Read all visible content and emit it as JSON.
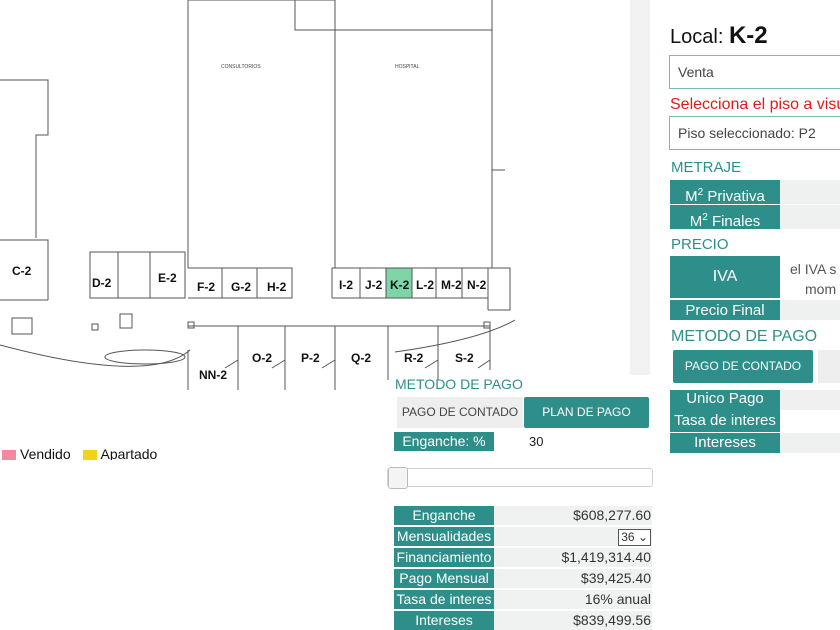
{
  "floorplan": {
    "zones": [
      "CONSULTORIOS",
      "HOSPITAL"
    ],
    "units_top": [
      "C-2",
      "D-2",
      "E-2",
      "F-2",
      "G-2",
      "H-2",
      "I-2",
      "J-2",
      "K-2",
      "L-2",
      "M-2",
      "N-2"
    ],
    "units_bottom": [
      "NN-2",
      "O-2",
      "P-2",
      "Q-2",
      "R-2",
      "S-2"
    ],
    "selected_unit": "K-2",
    "selected_color": "#7ed6a8",
    "legend": [
      {
        "label": "Vendido",
        "color": "#f08aa0"
      },
      {
        "label": "Apartado",
        "color": "#f3d21a"
      }
    ]
  },
  "local": {
    "prefix": "Local:",
    "name": "K-2",
    "status_value": "Venta",
    "warning": "Selecciona el piso a visual",
    "floor_value": "Piso seleccionado: P2"
  },
  "metraje": {
    "title": "METRAJE",
    "privativa_label": "Privativa",
    "finales_label": "Finales",
    "unit": "M",
    "sup": "2"
  },
  "precio": {
    "title": "PRECIO",
    "iva_label": "IVA",
    "iva_text_1": "el IVA s",
    "iva_text_2": "mom",
    "final_label": "Precio Final"
  },
  "metodo_right": {
    "title": "METODO DE PAGO",
    "button": "PAGO DE CONTADO",
    "unico": "Unico Pago",
    "tasa": "Tasa de interes",
    "intereses": "Intereses"
  },
  "payment": {
    "title": "METODO DE PAGO",
    "tab_contado": "PAGO DE CONTADO",
    "tab_plan": "PLAN DE PAGO",
    "enganche_pct_label": "Enganche: %",
    "enganche_pct_value": "30",
    "slider_fraction": 0,
    "rows": [
      {
        "label": "Enganche",
        "value": "$608,277.60"
      },
      {
        "label": "Mensualidades",
        "value": "36"
      },
      {
        "label": "Financiamiento",
        "value": "$1,419,314.40"
      },
      {
        "label": "Pago Mensual",
        "value": "$39,425.40"
      },
      {
        "label": "Tasa de interes",
        "value": "16% anual"
      },
      {
        "label": "Intereses",
        "value": "$839,499.56"
      }
    ]
  }
}
